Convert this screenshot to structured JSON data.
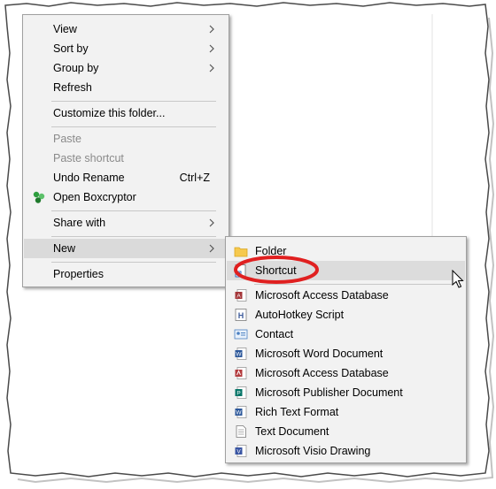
{
  "context_menu": {
    "items": [
      {
        "label": "View",
        "has_submenu": true
      },
      {
        "label": "Sort by",
        "has_submenu": true
      },
      {
        "label": "Group by",
        "has_submenu": true
      },
      {
        "label": "Refresh"
      },
      {
        "label": "Customize this folder..."
      },
      {
        "label": "Paste",
        "disabled": true
      },
      {
        "label": "Paste shortcut",
        "disabled": true
      },
      {
        "label": "Undo Rename",
        "shortcut": "Ctrl+Z"
      },
      {
        "label": "Open Boxcryptor",
        "icon": "boxcryptor-icon"
      },
      {
        "label": "Share with",
        "has_submenu": true
      },
      {
        "label": "New",
        "has_submenu": true,
        "active": true
      },
      {
        "label": "Properties"
      }
    ]
  },
  "new_submenu": {
    "items": [
      {
        "label": "Folder",
        "icon": "folder-icon"
      },
      {
        "label": "Shortcut",
        "icon": "shortcut-icon",
        "highlighted": true
      },
      {
        "label": "Microsoft Access Database",
        "icon": "access-icon"
      },
      {
        "label": "AutoHotkey Script",
        "icon": "autohotkey-icon"
      },
      {
        "label": "Contact",
        "icon": "contact-icon"
      },
      {
        "label": "Microsoft Word Document",
        "icon": "word-icon"
      },
      {
        "label": "Microsoft Access Database",
        "icon": "access-icon"
      },
      {
        "label": "Microsoft Publisher Document",
        "icon": "publisher-icon"
      },
      {
        "label": "Rich Text Format",
        "icon": "rtf-icon"
      },
      {
        "label": "Text Document",
        "icon": "text-document-icon"
      },
      {
        "label": "Microsoft Visio Drawing",
        "icon": "visio-icon"
      }
    ]
  },
  "colors": {
    "menu_bg": "#f2f2f2",
    "hover_bg": "#dadada",
    "highlight_ring": "#e02020",
    "disabled_text": "#8a8a8a"
  }
}
